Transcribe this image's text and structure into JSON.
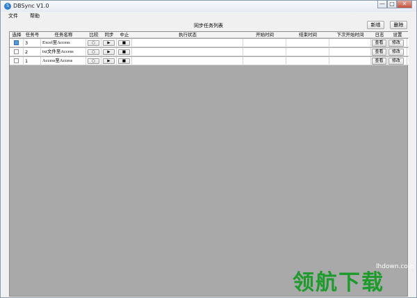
{
  "window": {
    "title": "DBSync V1.0",
    "icon": "app-logo-icon"
  },
  "titlebar_buttons": {
    "minimize": "—",
    "maximize": "□",
    "close": "✕"
  },
  "menu": [
    "文件",
    "帮助"
  ],
  "table_title": "同步任务列表",
  "toolbar": {
    "add_label": "新增",
    "delete_label": "删除"
  },
  "columns": [
    "选择",
    "任务号",
    "任务名称",
    "比较",
    "同步",
    "中止",
    "执行状态",
    "开始时间",
    "结束时间",
    "下次开始时间",
    "日志",
    "设置"
  ],
  "rows": [
    {
      "selected": true,
      "id": "3",
      "name": "Excel至Access",
      "compare": "○",
      "sync": "▶",
      "stop": "■",
      "status": "",
      "start": "",
      "end": "",
      "next": "",
      "log": "查看",
      "settings": "修改"
    },
    {
      "selected": false,
      "id": "2",
      "name": "txt文件至Access",
      "compare": "○",
      "sync": "▶",
      "stop": "■",
      "status": "",
      "start": "",
      "end": "",
      "next": "",
      "log": "查看",
      "settings": "修改"
    },
    {
      "selected": false,
      "id": "1",
      "name": "Access至Access",
      "compare": "○",
      "sync": "▶",
      "stop": "■",
      "status": "",
      "start": "",
      "end": "",
      "next": "",
      "log": "查看",
      "settings": "修改"
    }
  ],
  "watermark": {
    "url": "lhdown.com",
    "text": "领航下载"
  },
  "colors": {
    "grid_background": "#a9a9a9",
    "selected_checkbox": "#4f9be0",
    "watermark": "#1d9c2c"
  }
}
